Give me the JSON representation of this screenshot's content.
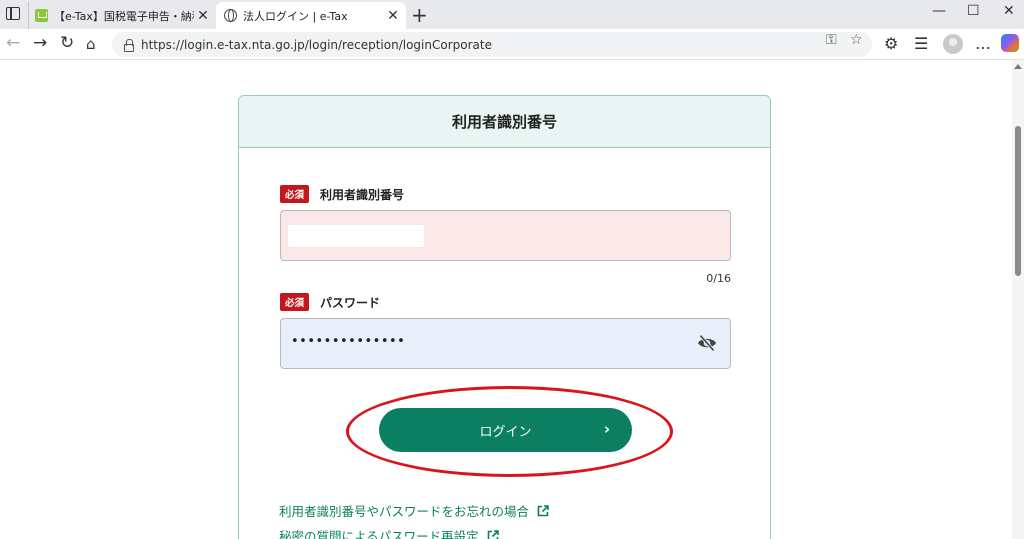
{
  "browser": {
    "tabs": [
      {
        "title": "【e-Tax】国税電子申告・納税システム",
        "icon": "etax-favicon",
        "active": false
      },
      {
        "title": "法人ログイン | e-Tax",
        "icon": "globe-icon",
        "active": true
      }
    ],
    "new_tab_label": "+",
    "url": "https://login.e-tax.nta.go.jp/login/reception/loginCorporate"
  },
  "page": {
    "card_title": "利用者識別番号",
    "user_id": {
      "required_badge": "必須",
      "label": "利用者識別番号",
      "value": "",
      "counter": "0/16"
    },
    "password": {
      "required_badge": "必須",
      "label": "パスワード",
      "masked_value": "••••••••••••••",
      "toggle_icon": "eye-off-icon"
    },
    "login_button": {
      "label": "ログイン",
      "chevron": "›"
    },
    "links": [
      {
        "label": "利用者識別番号やパスワードをお忘れの場合"
      },
      {
        "label": "秘密の質問によるパスワード再設定"
      }
    ],
    "annotation_color": "#d9141b",
    "accent_color": "#0c7f63"
  }
}
